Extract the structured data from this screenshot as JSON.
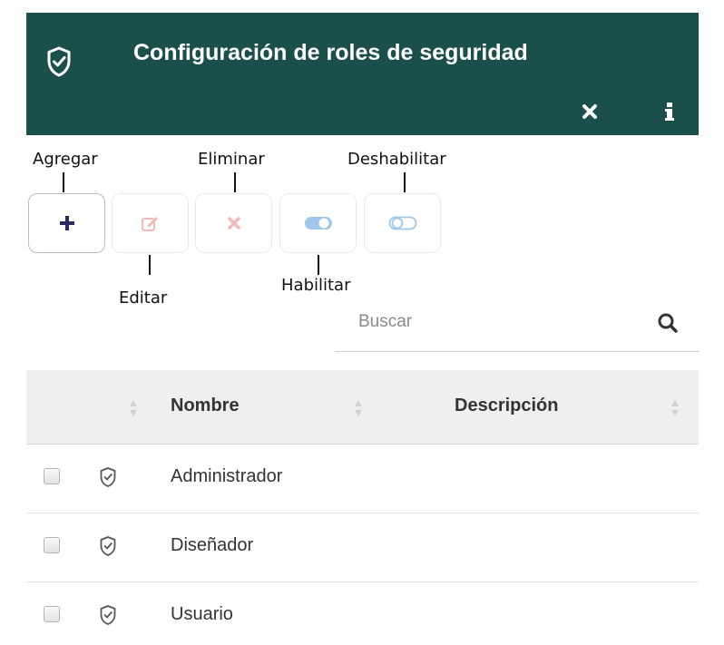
{
  "header": {
    "title": "Configuración de roles de seguridad",
    "icon": "shield-check-icon",
    "close_icon": "close-icon",
    "info_icon": "info-icon",
    "background": "#1b4f4c"
  },
  "toolbar": {
    "callouts": {
      "add": "Agregar",
      "edit": "Editar",
      "delete": "Eliminar",
      "enable": "Habilitar",
      "disable": "Deshabilitar"
    },
    "buttons": [
      {
        "action": "add",
        "icon": "plus-icon",
        "color": "#2c2a63"
      },
      {
        "action": "edit",
        "icon": "edit-icon",
        "color": "#f3b9b9"
      },
      {
        "action": "delete",
        "icon": "close-icon",
        "color": "#f3b9b9"
      },
      {
        "action": "enable",
        "icon": "toggle-on-icon",
        "color": "#9ec7ea"
      },
      {
        "action": "disable",
        "icon": "toggle-off-icon",
        "color": "#9ec7ea"
      }
    ]
  },
  "search": {
    "placeholder": "Buscar",
    "value": ""
  },
  "table": {
    "columns": [
      "Nombre",
      "Descripción"
    ],
    "rows": [
      {
        "name": "Administrador",
        "description": "",
        "checked": false
      },
      {
        "name": "Diseñador",
        "description": "",
        "checked": false
      },
      {
        "name": "Usuario",
        "description": "",
        "checked": false
      }
    ]
  }
}
